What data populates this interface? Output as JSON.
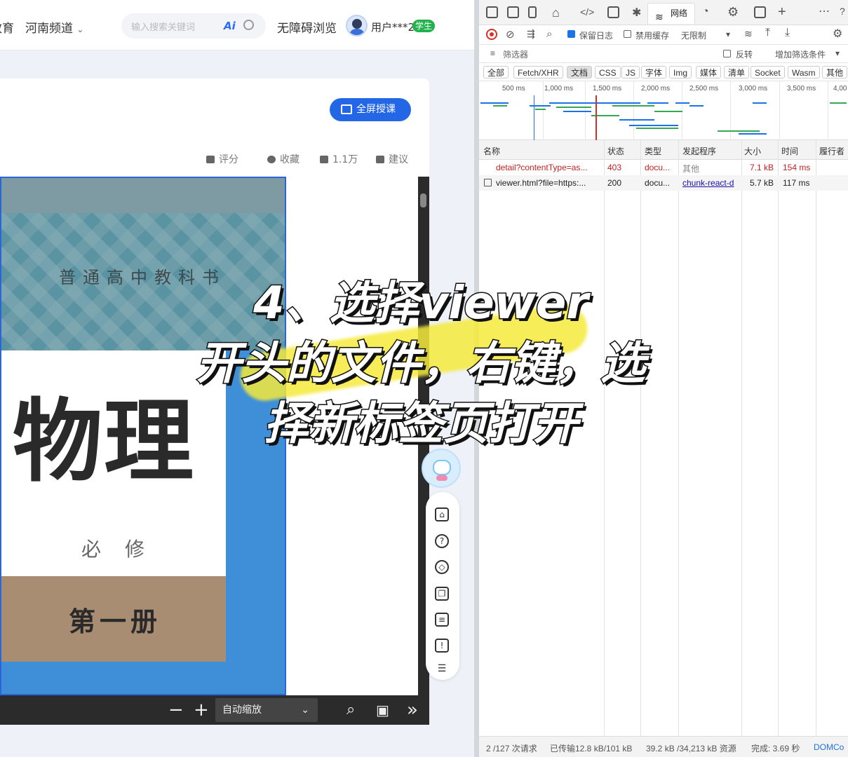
{
  "topnav": {
    "partial_item": "教育",
    "channel": "河南频道",
    "search_placeholder": "输入搜索关键词",
    "ai_label": "Ai",
    "accessibility": "无障碍浏览",
    "username": "用户***2",
    "user_badge": "学生"
  },
  "course_card": {
    "fullscreen_label": "全屏授课",
    "actions": [
      "评分",
      "收藏",
      "1.1万",
      "建议"
    ]
  },
  "book_cover": {
    "series": "普通高中教科书",
    "title": "物理",
    "subtitle": "必修",
    "volume": "第一册"
  },
  "viewer_toolbar": {
    "zoom_out": "−",
    "zoom_in": "+",
    "zoom_value": "自动缩放",
    "more": "»"
  },
  "float_icons": [
    "home-icon",
    "help-icon",
    "box-icon",
    "copy-icon",
    "note-icon",
    "feedback-icon",
    "menu-icon"
  ],
  "devtools": {
    "network_tab": "网络",
    "preserve_log": "保留日志",
    "disable_cache": "禁用缓存",
    "throttle": "无限制",
    "filter_placeholder": "筛选器",
    "invert": "反转",
    "more_filters": "增加筛选条件",
    "filter_types": [
      "全部",
      "Fetch/XHR",
      "文档",
      "CSS",
      "JS",
      "字体",
      "Img",
      "媒体",
      "清单",
      "Socket",
      "Wasm",
      "其他"
    ],
    "selected_filter": "文档",
    "timeline_ticks": [
      "500 ms",
      "1,000 ms",
      "1,500 ms",
      "2,000 ms",
      "2,500 ms",
      "3,000 ms",
      "3,500 ms",
      "4,00"
    ],
    "columns": [
      "名称",
      "状态",
      "类型",
      "发起程序",
      "大小",
      "时间",
      "履行者"
    ],
    "requests": [
      {
        "name": "detail?contentType=as...",
        "status": "403",
        "type": "docu...",
        "initiator": "其他",
        "size": "7.1 kB",
        "time": "154 ms"
      },
      {
        "name": "viewer.html?file=https:...",
        "status": "200",
        "type": "docu...",
        "initiator": "chunk-react-d",
        "size": "5.7 kB",
        "time": "117 ms"
      }
    ],
    "status_bar": {
      "requests": "2 /127 次请求",
      "transferred": "已传输12.8 kB/101 kB",
      "resources": "39.2 kB /34,213 kB 资源",
      "finish": "完成: 3.69 秒",
      "dom": "DOMCo"
    }
  },
  "caption": {
    "line1": "4、选择viewer",
    "line2": "开头的文件，右键，选",
    "line3": "择新标签页打开"
  },
  "colors": {
    "accent_blue": "#2467e6",
    "badge_green": "#21b24c",
    "error_red": "#d93025",
    "highlight_yellow": "#f5ea3c"
  }
}
